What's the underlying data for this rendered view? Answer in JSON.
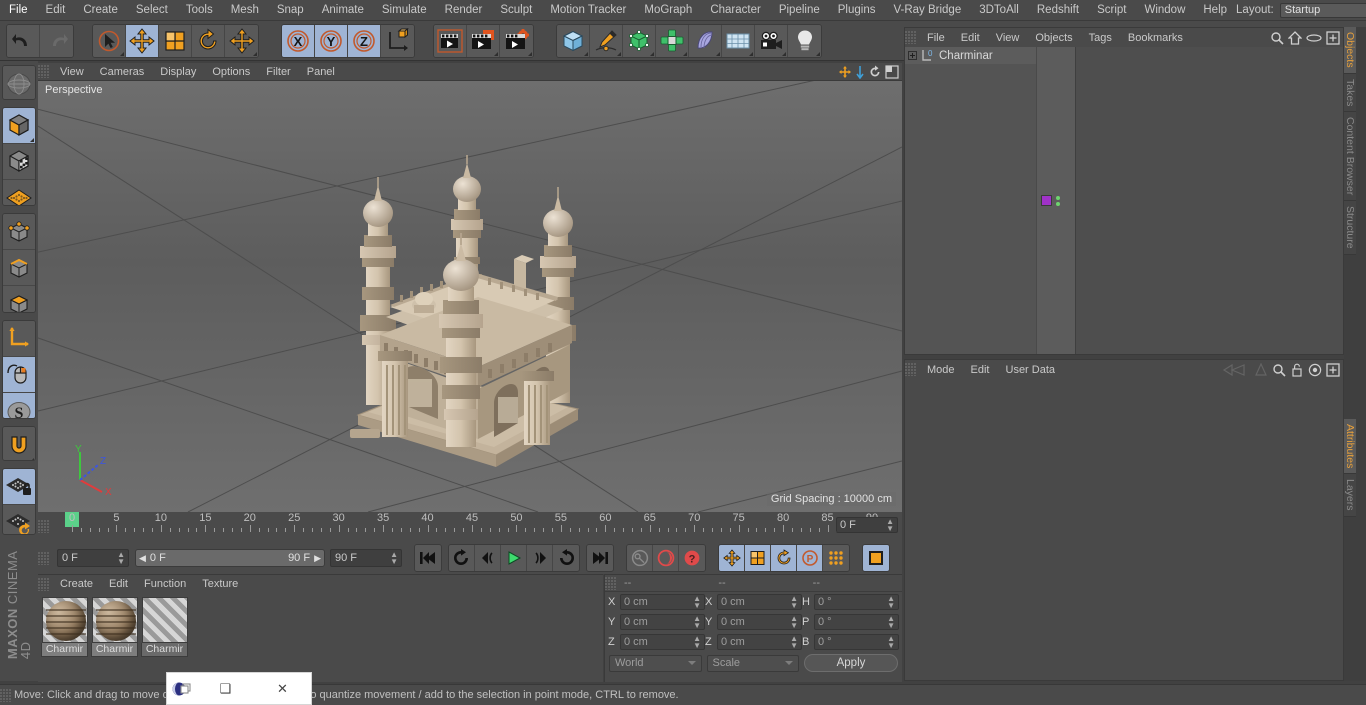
{
  "app": {
    "brand_top": "MAXON",
    "brand_bottom": "CINEMA 4D"
  },
  "menubar": {
    "items": [
      {
        "label": "File"
      },
      {
        "label": "Edit"
      },
      {
        "label": "Create"
      },
      {
        "label": "Select"
      },
      {
        "label": "Tools"
      },
      {
        "label": "Mesh"
      },
      {
        "label": "Snap"
      },
      {
        "label": "Animate"
      },
      {
        "label": "Simulate"
      },
      {
        "label": "Render"
      },
      {
        "label": "Sculpt"
      },
      {
        "label": "Motion Tracker"
      },
      {
        "label": "MoGraph"
      },
      {
        "label": "Character"
      },
      {
        "label": "Pipeline"
      },
      {
        "label": "Plugins"
      },
      {
        "label": "V-Ray Bridge"
      },
      {
        "label": "3DToAll"
      },
      {
        "label": "Redshift"
      },
      {
        "label": "Script"
      },
      {
        "label": "Window"
      },
      {
        "label": "Help"
      }
    ],
    "layout_label": "Layout:",
    "layout_value": "Startup"
  },
  "toolbar": {
    "undo": "undo-arrow",
    "redo": "redo-arrow",
    "live_selection": "live-selection-tool",
    "move": "move-tool",
    "scale": "scale-tool",
    "rotate": "rotate-tool",
    "move_dup": "move-tool-alt",
    "axis_x": "X",
    "axis_y": "Y",
    "axis_z": "Z",
    "world_axis": "world-coordinate-system",
    "render_view": "render-view",
    "render_region": "render-to-picture-viewer",
    "render_settings": "render-settings",
    "cube": "primitive-cube",
    "spline": "spline-pen",
    "nurbs": "subdivision-surface",
    "mograph": "mograph-cloner",
    "deformer": "bend-deformer",
    "scene": "floor-environment",
    "camera": "camera-object",
    "light": "light-object"
  },
  "left_toolbar": {
    "items": [
      {
        "name": "make-editable",
        "selected": false
      },
      {
        "name": "model-mode",
        "selected": true
      },
      {
        "name": "texture-mode",
        "selected": false
      },
      {
        "name": "workplane-mode",
        "selected": false
      },
      {
        "name": "points-mode",
        "selected": false
      },
      {
        "name": "edges-mode",
        "selected": false
      },
      {
        "name": "polygons-mode",
        "selected": false
      },
      {
        "name": "object-axis-mode",
        "selected": false
      },
      {
        "name": "enable-axis-modification",
        "selected": true
      },
      {
        "name": "soft-selection",
        "selected": true
      },
      {
        "name": "snap-enable",
        "selected": false
      },
      {
        "name": "lock-workplane",
        "selected": true
      },
      {
        "name": "planar-workplane",
        "selected": false
      }
    ]
  },
  "viewport": {
    "menu": [
      "View",
      "Cameras",
      "Display",
      "Options",
      "Filter",
      "Panel"
    ],
    "label": "Perspective",
    "grid_spacing": "Grid Spacing : 10000 cm",
    "axes": {
      "x": "X",
      "y": "Y",
      "z": "Z"
    },
    "scene_object": "Charminar"
  },
  "timeline": {
    "ticks": [
      0,
      5,
      10,
      15,
      20,
      25,
      30,
      35,
      40,
      45,
      50,
      55,
      60,
      65,
      70,
      75,
      80,
      85,
      90
    ],
    "current_frame_field": "0 F",
    "playhead_frame": 0
  },
  "animbar": {
    "current_frame": "0 F",
    "range_start": "0 F",
    "range_end": "90 F",
    "max_frame": "90 F",
    "buttons": [
      {
        "name": "go-to-start",
        "icon": "skip-start"
      },
      {
        "name": "play-backwards",
        "icon": "play-reverse"
      },
      {
        "name": "go-to-previous-frame",
        "icon": "step-back"
      },
      {
        "name": "play-forward",
        "icon": "play"
      },
      {
        "name": "go-to-next-frame",
        "icon": "step-forward"
      },
      {
        "name": "loop-playback",
        "icon": "loop"
      },
      {
        "name": "go-to-end",
        "icon": "skip-end"
      }
    ],
    "key_buttons": [
      {
        "name": "record-active-objects",
        "icon": "key"
      },
      {
        "name": "autokeying",
        "icon": "auto-key"
      },
      {
        "name": "keyframe-selection",
        "icon": "question-key"
      }
    ],
    "record_toggles": [
      {
        "name": "position-key",
        "icon": "move",
        "selected": true
      },
      {
        "name": "scale-key",
        "icon": "scale",
        "selected": true
      },
      {
        "name": "rotation-key",
        "icon": "rotate",
        "selected": true
      },
      {
        "name": "parameter-key",
        "icon": "parameter",
        "selected": true
      },
      {
        "name": "point-level-animation",
        "icon": "pla",
        "selected": false
      }
    ],
    "timeline_toggle": {
      "name": "timeline-mode",
      "selected": true
    }
  },
  "materials": {
    "menu": [
      "Create",
      "Edit",
      "Function",
      "Texture"
    ],
    "items": [
      {
        "name": "Charmir",
        "selected": true,
        "has_preview": true
      },
      {
        "name": "Charmir",
        "selected": true,
        "has_preview": true
      },
      {
        "name": "Charmir",
        "selected": false,
        "has_preview": false
      }
    ]
  },
  "coordinates": {
    "headers": [
      "--",
      "--",
      "--"
    ],
    "position": {
      "label_x": "X",
      "label_y": "Y",
      "label_z": "Z",
      "x": "0 cm",
      "y": "0 cm",
      "z": "0 cm"
    },
    "size": {
      "label_x": "X",
      "label_y": "Y",
      "label_z": "Z",
      "x": "0 cm",
      "y": "0 cm",
      "z": "0 cm"
    },
    "rotation": {
      "label_h": "H",
      "label_p": "P",
      "label_b": "B",
      "h": "0 °",
      "p": "0 °",
      "b": "0 °"
    },
    "system": "World",
    "mode": "Scale",
    "apply": "Apply"
  },
  "object_manager": {
    "menu": [
      "File",
      "Edit",
      "View",
      "Objects",
      "Tags",
      "Bookmarks"
    ],
    "rows": [
      {
        "name": "Charminar",
        "layer_badge": "0",
        "tag_color": "#a032c8"
      }
    ]
  },
  "attribute_manager": {
    "menu": [
      "Mode",
      "Edit",
      "User Data"
    ]
  },
  "vtabs_right": [
    {
      "label": "Objects",
      "active": true
    },
    {
      "label": "Takes",
      "active": false
    },
    {
      "label": "Content Browser",
      "active": false
    },
    {
      "label": "Structure",
      "active": false
    }
  ],
  "vtabs_right_lower": [
    {
      "label": "Attributes",
      "active": true
    },
    {
      "label": "Layers",
      "active": false
    }
  ],
  "statusbar": {
    "text": "Move: Click and drag to move objects and elements, SHIFT to quantize movement / add to the selection in point mode, CTRL to remove."
  },
  "float_window": {
    "icon": "cinema4d-app-icon",
    "restore": "❑",
    "close": "✕"
  },
  "colors": {
    "panel_bg": "#4a4a4a",
    "button_bg": "#595959",
    "selected_blue": "#9fb4d4",
    "accent_orange": "#e8a13c",
    "playhead_green": "#5bd18a",
    "tag_purple": "#a032c8",
    "viewport_top": "#676767",
    "monument": "#cbbba6"
  }
}
